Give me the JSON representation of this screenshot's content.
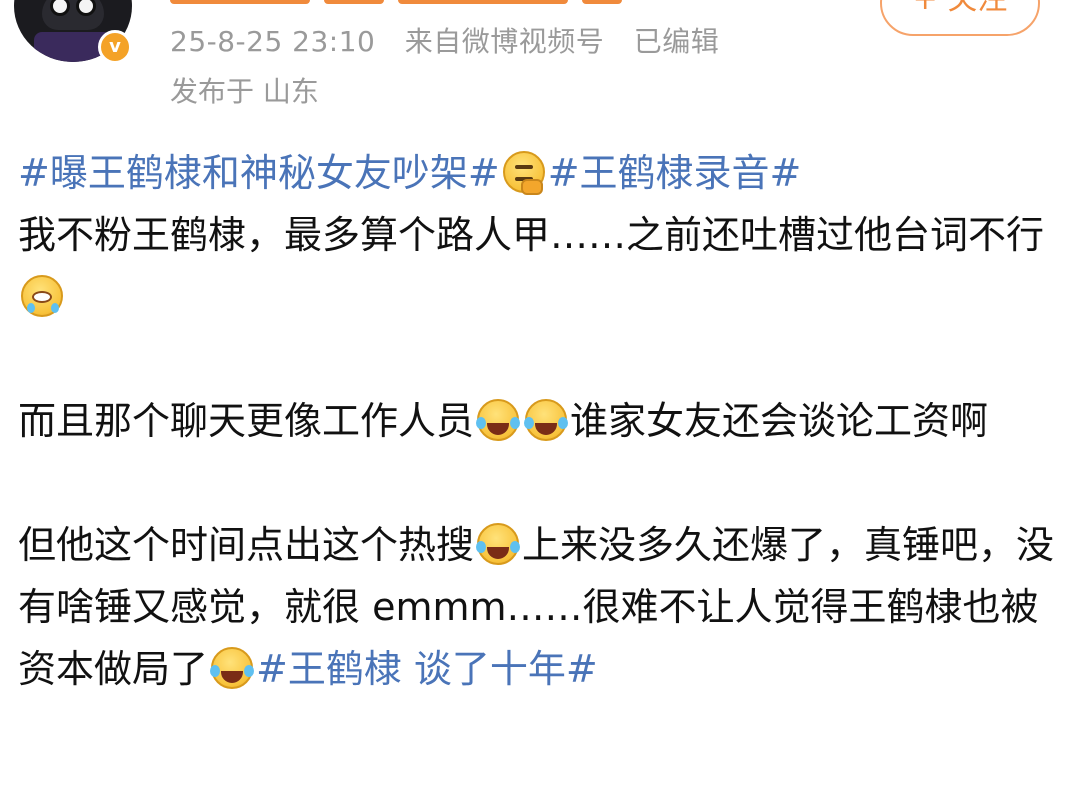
{
  "header": {
    "meta": {
      "time": "25-8-25 23:10",
      "source": "来自微博视频号",
      "edited": "已编辑"
    },
    "location": "发布于 山东",
    "follow_label": "+ 关注",
    "badge_label": "v"
  },
  "post": {
    "line1": {
      "tag1": "#曝王鹤棣和神秘女友吵架#",
      "tag2": "#王鹤棣录音#"
    },
    "para1": {
      "text": "我不粉王鹤棣，最多算个路人甲……之前还吐槽过他台词不行"
    },
    "para2": {
      "text_a": "而且那个聊天更像工作人员",
      "text_b": "谁家女友还会谈论工资啊"
    },
    "para3": {
      "text_a": "但他这个时间点出这个热搜",
      "text_b": "上来没多久还爆了，真锤吧，没有啥锤又感觉，就很 emmm……很难不让人觉得王鹤棣也被资本做局了",
      "tag": "#王鹤棣 谈了十年#"
    }
  },
  "icons": {
    "think": "thinking-face-icon",
    "cry": "crying-face-icon",
    "laugh": "laughing-tears-icon"
  },
  "colors": {
    "hashtag": "#4a74b8",
    "accent": "#f08a3c",
    "meta_gray": "#9a9a9a",
    "badge": "#f4a227"
  }
}
